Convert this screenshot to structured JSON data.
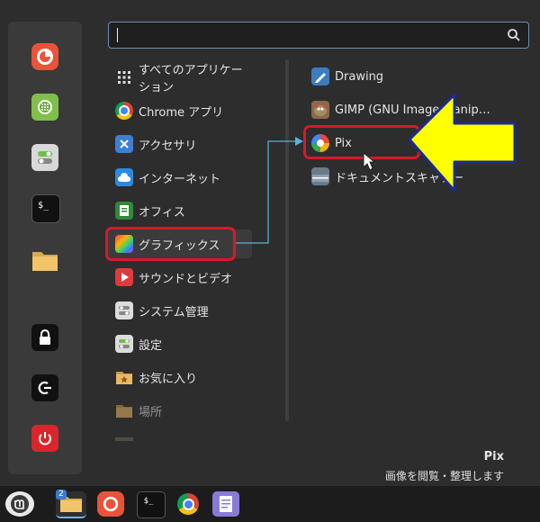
{
  "search": {
    "value": "",
    "placeholder": ""
  },
  "categories": [
    {
      "label": "すべてのアプリケーション",
      "icon": "grid-icon"
    },
    {
      "label": "Chrome アプリ",
      "icon": "chrome-icon"
    },
    {
      "label": "アクセサリ",
      "icon": "accessories-icon"
    },
    {
      "label": "インターネット",
      "icon": "internet-icon"
    },
    {
      "label": "オフィス",
      "icon": "office-icon"
    },
    {
      "label": "グラフィックス",
      "icon": "graphics-icon"
    },
    {
      "label": "サウンドとビデオ",
      "icon": "media-icon"
    },
    {
      "label": "システム管理",
      "icon": "system-admin-icon"
    },
    {
      "label": "設定",
      "icon": "settings-icon"
    },
    {
      "label": "お気に入り",
      "icon": "favorites-folder-icon"
    },
    {
      "label": "場所",
      "icon": "places-folder-icon"
    }
  ],
  "apps": [
    {
      "label": "Drawing",
      "icon": "drawing-icon"
    },
    {
      "label": "GIMP (GNU Image Manip…",
      "icon": "gimp-icon"
    },
    {
      "label": "Pix",
      "icon": "pix-icon"
    },
    {
      "label": "ドキュメントスキャナー",
      "icon": "scanner-icon"
    }
  ],
  "description": {
    "title": "Pix",
    "subtitle": "画像を閲覧・整理します"
  },
  "taskbar": {
    "badge": "2"
  },
  "colors": {
    "highlight_red": "#d7192a",
    "arrow_yellow": "#ffff00",
    "arrow_border": "#1a2a9a",
    "connector": "#5ab4d8"
  }
}
